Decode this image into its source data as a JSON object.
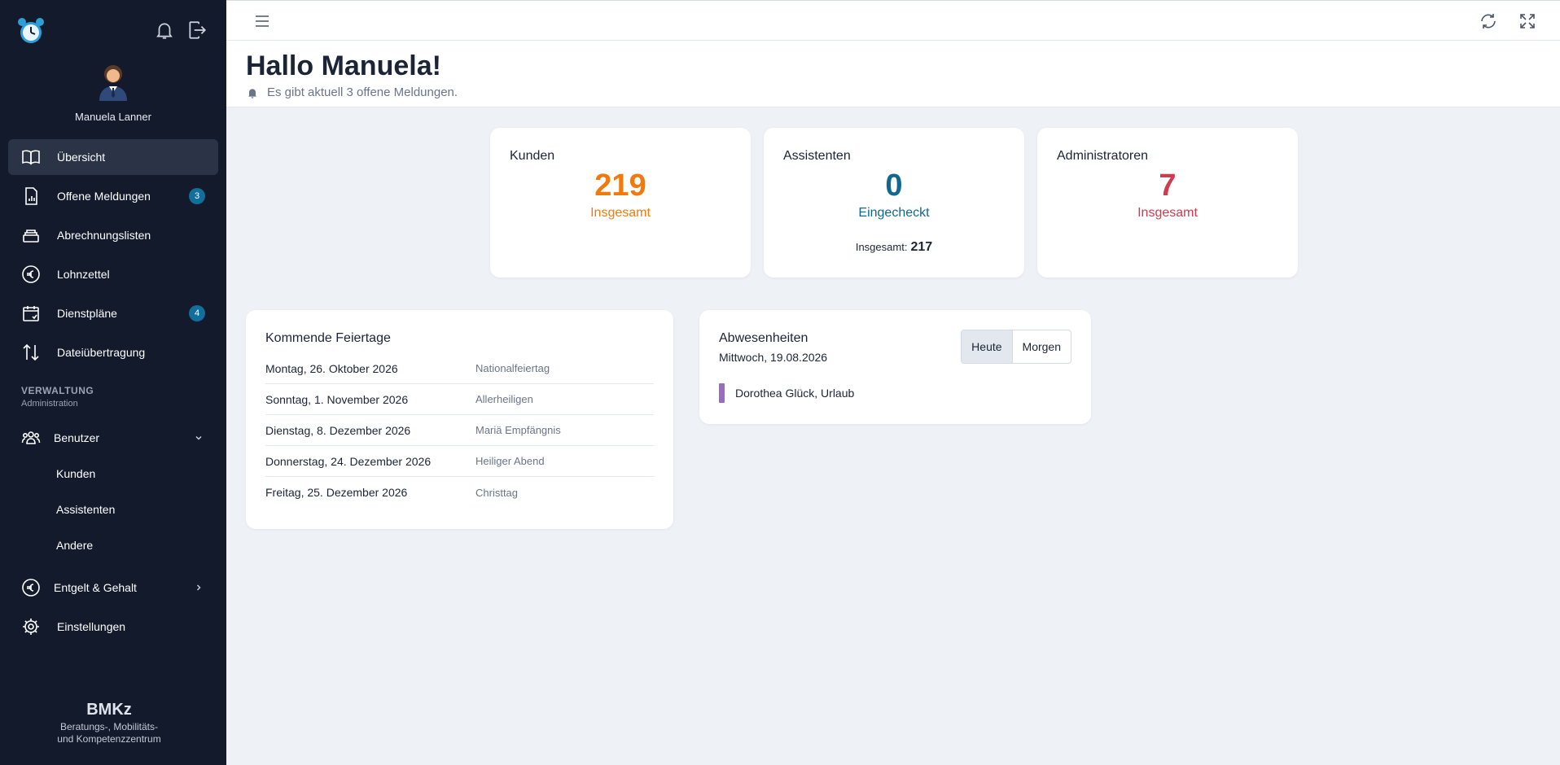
{
  "user": {
    "name": "Manuela Lanner"
  },
  "nav": {
    "items": [
      {
        "label": "Übersicht",
        "icon": "book-icon"
      },
      {
        "label": "Offene Meldungen",
        "icon": "report-icon",
        "badge": "3"
      },
      {
        "label": "Abrechnungslisten",
        "icon": "stack-icon"
      },
      {
        "label": "Lohnzettel",
        "icon": "euro-icon"
      },
      {
        "label": "Dienstpläne",
        "icon": "calendar-icon",
        "badge": "4"
      },
      {
        "label": "Dateiübertragung",
        "icon": "transfer-icon"
      }
    ],
    "section_title": "VERWALTUNG",
    "section_sub": "Administration",
    "benutzer": "Benutzer",
    "sub": [
      "Kunden",
      "Assistenten",
      "Andere"
    ],
    "entgelt": "Entgelt & Gehalt",
    "einstellungen": "Einstellungen"
  },
  "brand": {
    "name": "BMKz",
    "line1": "Beratungs-, Mobilitäts-",
    "line2": "und Kompetenzzentrum"
  },
  "header": {
    "greeting": "Hallo Manuela!",
    "notice": "Es gibt aktuell 3 offene Meldungen."
  },
  "stats": [
    {
      "title": "Kunden",
      "value": "219",
      "label": "Insgesamt",
      "color": "#f07a0e"
    },
    {
      "title": "Assistenten",
      "value": "0",
      "label": "Eingecheckt",
      "color": "#10688f",
      "total_label": "Insgesamt:",
      "total": "217"
    },
    {
      "title": "Administratoren",
      "value": "7",
      "label": "Insgesamt",
      "color": "#d13a4f"
    }
  ],
  "holidays": {
    "title": "Kommende Feiertage",
    "rows": [
      {
        "date": "Montag, 26. Oktober 2026",
        "name": "Nationalfeiertag"
      },
      {
        "date": "Sonntag, 1. November 2026",
        "name": "Allerheiligen"
      },
      {
        "date": "Dienstag, 8. Dezember 2026",
        "name": "Mariä Empfängnis"
      },
      {
        "date": "Donnerstag, 24. Dezember 2026",
        "name": "Heiliger Abend"
      },
      {
        "date": "Freitag, 25. Dezember 2026",
        "name": "Christtag"
      }
    ]
  },
  "absences": {
    "title": "Abwesenheiten",
    "date": "Mittwoch, 19.08.2026",
    "tab_today": "Heute",
    "tab_tomorrow": "Morgen",
    "entry": "Dorothea Glück, Urlaub"
  }
}
